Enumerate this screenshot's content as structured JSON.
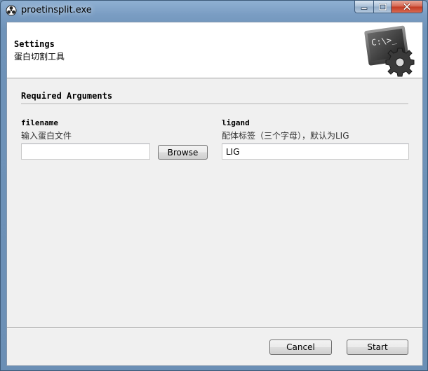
{
  "window": {
    "title": "proetinsplit.exe",
    "app_icon": "app-icon",
    "controls": [
      "minimize-icon",
      "maximize-icon",
      "close-icon"
    ]
  },
  "header": {
    "title": "Settings",
    "subtitle": "蛋白切割工具",
    "logo_icon": "terminal-gear-icon",
    "logo_text": "C:\\>_"
  },
  "section": {
    "title": "Required Arguments"
  },
  "fields": {
    "filename": {
      "name": "filename",
      "help": "输入蛋白文件",
      "value": "",
      "browse_label": "Browse"
    },
    "ligand": {
      "name": "ligand",
      "help": "配体标签（三个字母），默认为LIG",
      "value": "LIG"
    }
  },
  "footer": {
    "cancel_label": "Cancel",
    "start_label": "Start"
  },
  "colors": {
    "frame": "#6f93b9",
    "client_bg": "#f0f0f0",
    "header_bg": "#ffffff",
    "close_button": "#c23a22"
  }
}
